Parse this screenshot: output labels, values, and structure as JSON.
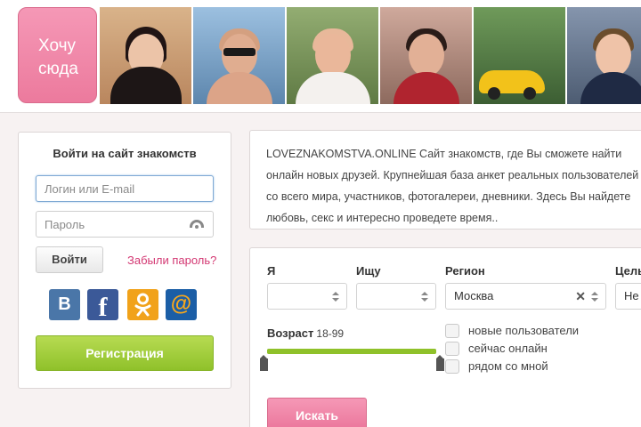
{
  "header": {
    "want_here_label": "Хочу сюда",
    "profiles": [
      {
        "name": "profile-woman-fur-coat",
        "colors": {
          "bg": "#cfa37a",
          "body": "#1d1616",
          "hair": "#201414"
        }
      },
      {
        "name": "profile-man-sunglasses",
        "colors": {
          "bg": "#7fa6c9",
          "body": "#e0ad90",
          "hair": "#6b4a36"
        }
      },
      {
        "name": "profile-man-white-shirt",
        "colors": {
          "bg": "#7f9860",
          "body": "#f4f1ee",
          "hair": "#e8b89a"
        }
      },
      {
        "name": "profile-man-pillow",
        "colors": {
          "bg": "#b88d80",
          "body": "#b0242f",
          "hair": "#2a1c18"
        }
      },
      {
        "name": "profile-man-yellow-car",
        "colors": {
          "bg": "#4e7a3f",
          "body": "#f2c21a",
          "hair": "#2a2a2a"
        }
      },
      {
        "name": "profile-man-hoodie",
        "colors": {
          "bg": "#6e7e95",
          "body": "#1f2a44",
          "hair": "#6b4d2d"
        }
      }
    ]
  },
  "login": {
    "title": "Войти на сайт знакомств",
    "login_placeholder": "Логин или E-mail",
    "password_placeholder": "Пароль",
    "login_button": "Войти",
    "forgot_link": "Забыли пароль?",
    "social": [
      {
        "name": "vk-icon",
        "glyph": "В"
      },
      {
        "name": "facebook-icon",
        "glyph": "f"
      },
      {
        "name": "odnoklassniki-icon",
        "glyph": "ok"
      },
      {
        "name": "mail-ru-icon",
        "glyph": "@"
      }
    ],
    "register_button": "Регистрация"
  },
  "description": {
    "text": "LOVEZNAKOMSTVA.ONLINE Сайт знакомств, где Вы сможете найти онлайн новых друзей. Крупнейшая база анкет реальных пользователей со всего мира, участников, фотогалереи, дневники. Здесь Вы найдете любовь, секс и интересно проведете время.."
  },
  "search": {
    "labels": {
      "i_am": "Я",
      "seeking": "Ищу",
      "region": "Регион",
      "goal": "Цель"
    },
    "region_value": "Москва",
    "goal_value": "Не",
    "age_label": "Возраст",
    "age_range": "18-99",
    "age_range_fill": 1.0,
    "checkboxes": [
      "новые пользователи",
      "сейчас онлайн",
      "рядом со мной"
    ],
    "search_button": "Искать"
  }
}
